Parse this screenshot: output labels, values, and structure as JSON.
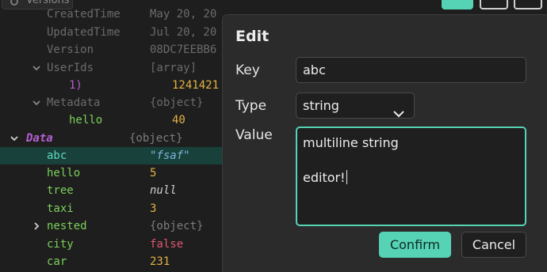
{
  "colors": {
    "accent": "#56d3b4",
    "selected_row": "#17413a",
    "modal_bg": "#2b2b2b"
  },
  "topbar": {
    "versions_label": "Versions"
  },
  "tree": {
    "rows": [
      {
        "key": "CreatedTime",
        "value": "May 20, 20"
      },
      {
        "key": "UpdatedTime",
        "value": "Jul 20, 20"
      },
      {
        "key": "Version",
        "value": "08DC7EEBB6"
      },
      {
        "key": "UserIds",
        "value": "[array]"
      },
      {
        "key": "1)",
        "value": "1241421"
      },
      {
        "key": "Metadata",
        "value": "{object}"
      },
      {
        "key": "hello",
        "value": "40"
      },
      {
        "key": "Data",
        "value": "{object}"
      },
      {
        "key": "abc",
        "value": "\"fsaf\""
      },
      {
        "key": "hello",
        "value": "5"
      },
      {
        "key": "tree",
        "value": "null"
      },
      {
        "key": "taxi",
        "value": "3"
      },
      {
        "key": "nested",
        "value": "{object}"
      },
      {
        "key": "city",
        "value": "false"
      },
      {
        "key": "car",
        "value": "231"
      }
    ]
  },
  "modal": {
    "title": "Edit",
    "key_label": "Key",
    "key_value": "abc",
    "type_label": "Type",
    "type_value": "string",
    "value_label": "Value",
    "value_lines": [
      "multiline string",
      "",
      "editor!"
    ],
    "confirm_label": "Confirm",
    "cancel_label": "Cancel"
  }
}
